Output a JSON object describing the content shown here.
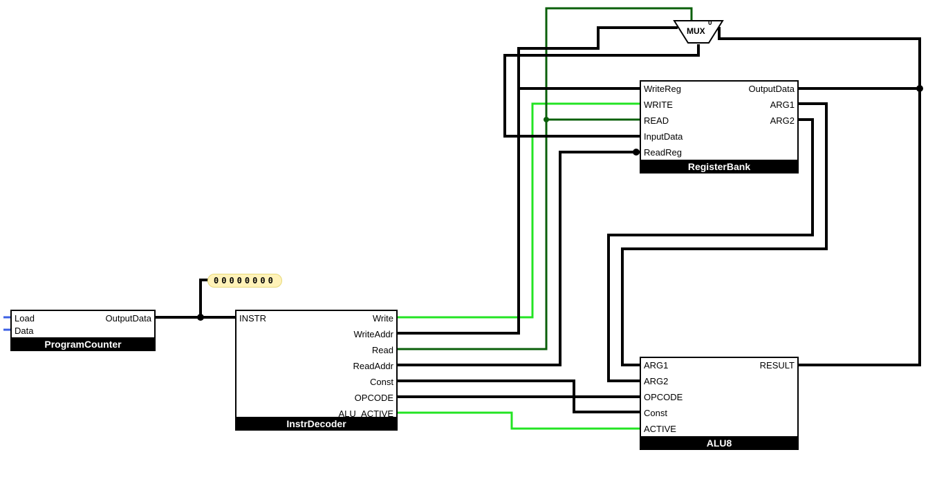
{
  "blocks": {
    "pc": {
      "title": "ProgramCounter",
      "ports": {
        "load": "Load",
        "data": "Data",
        "out": "OutputData"
      }
    },
    "dec": {
      "title": "InstrDecoder",
      "ports": {
        "instr": "INSTR",
        "write": "Write",
        "writeAddr": "WriteAddr",
        "read": "Read",
        "readAddr": "ReadAddr",
        "const": "Const",
        "opcode": "OPCODE",
        "aluActive": "ALU_ACTIVE"
      }
    },
    "rb": {
      "title": "RegisterBank",
      "ports": {
        "writeReg": "WriteReg",
        "write": "WRITE",
        "read": "READ",
        "inputData": "InputData",
        "readReg": "ReadReg",
        "outputData": "OutputData",
        "arg1": "ARG1",
        "arg2": "ARG2"
      }
    },
    "alu": {
      "title": "ALU8",
      "ports": {
        "arg1": "ARG1",
        "arg2": "ARG2",
        "opcode": "OPCODE",
        "const": "Const",
        "active": "ACTIVE",
        "result": "RESULT"
      }
    }
  },
  "mux": {
    "label": "MUX",
    "sel": "0"
  },
  "bits": "00000000",
  "colors": {
    "wire": "#000000",
    "signalBright": "#23e423",
    "signalDark": "#0a5f0a",
    "inputBlue": "#3b5fe3"
  }
}
